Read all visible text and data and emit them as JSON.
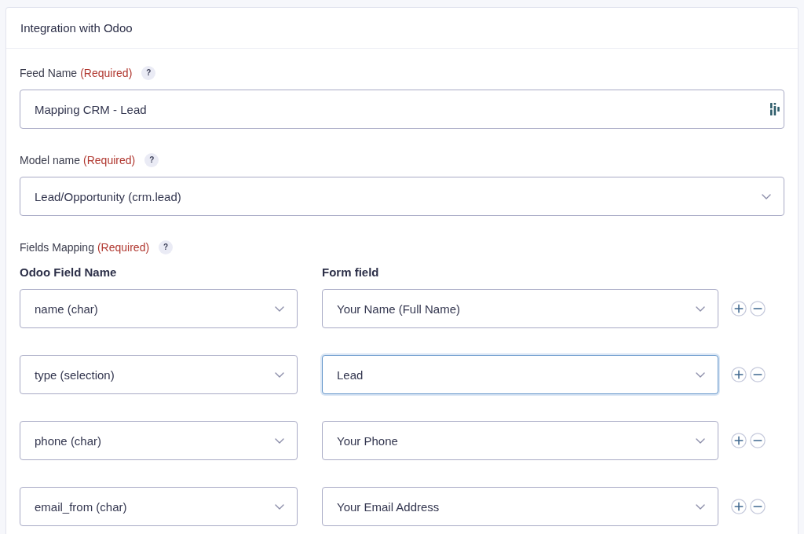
{
  "panel": {
    "title": "Integration with Odoo"
  },
  "fields": [
    {
      "kind": "text",
      "label": "Feed Name",
      "required_note": "(Required)",
      "help": "?",
      "value": "Mapping CRM - Lead"
    },
    {
      "kind": "select",
      "label": "Model name",
      "required_note": "(Required)",
      "help": "?",
      "value": "Lead/Opportunity (crm.lead)"
    }
  ],
  "mapping": {
    "label": "Fields Mapping",
    "required_note": "(Required)",
    "help": "?",
    "columns": [
      "Odoo Field Name",
      "Form field"
    ],
    "rows": [
      {
        "odoo_field": "name (char)",
        "form_field": "Your Name (Full Name)",
        "focused": false
      },
      {
        "odoo_field": "type (selection)",
        "form_field": "Lead",
        "focused": true
      },
      {
        "odoo_field": "phone (char)",
        "form_field": "Your Phone",
        "focused": false
      },
      {
        "odoo_field": "email_from (char)",
        "form_field": "Your Email Address",
        "focused": false
      }
    ]
  }
}
